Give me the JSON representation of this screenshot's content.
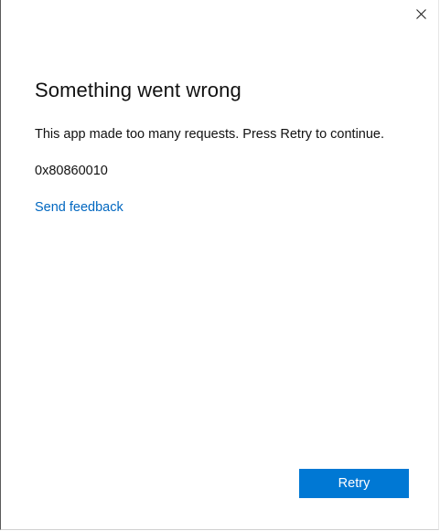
{
  "dialog": {
    "title": "Something went wrong",
    "message": "This app made too many requests. Press Retry to continue.",
    "error_code": "0x80860010",
    "feedback_link": "Send feedback",
    "retry_label": "Retry",
    "close_icon": "close-icon"
  },
  "colors": {
    "accent": "#0078d4",
    "link": "#0067c0",
    "text": "#111111",
    "background": "#ffffff"
  }
}
